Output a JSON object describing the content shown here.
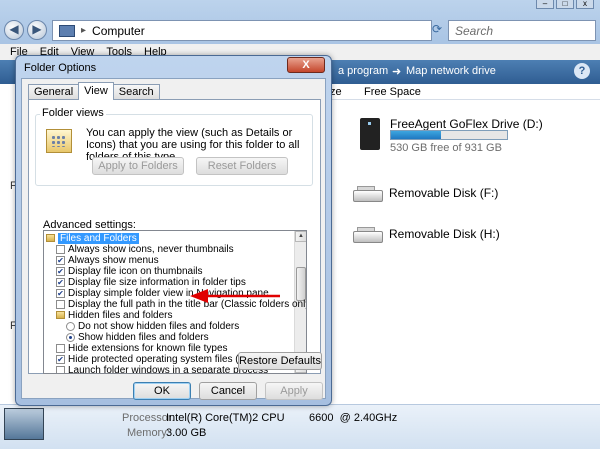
{
  "explorer": {
    "address": "Computer",
    "search_placeholder": "Search",
    "menu": [
      "File",
      "Edit",
      "View",
      "Tools",
      "Help"
    ],
    "toolbar": {
      "item1": "a program",
      "item2": "Map network drive",
      "help_icon": "?"
    },
    "columns": {
      "size": "ze",
      "free_space": "Free Space"
    },
    "drives": [
      {
        "name": "FreeAgent GoFlex Drive (D:)",
        "free_text": "530 GB free of 931 GB",
        "used_fraction": 0.43
      },
      {
        "name": "Removable Disk (F:)"
      },
      {
        "name": "Removable Disk (H:)"
      }
    ],
    "details": {
      "processor_label": "Processor:",
      "processor_value": "Intel(R) Core(TM)2 CPU        6600  @ 2.40GHz",
      "memory_label": "Memory:",
      "memory_value": "3.00 GB"
    },
    "left_stubs": [
      "Fi",
      "Fo"
    ]
  },
  "dialog": {
    "title": "Folder Options",
    "close_glyph": "X",
    "tabs": [
      "General",
      "View",
      "Search"
    ],
    "active_tab": "View",
    "folder_views": {
      "title": "Folder views",
      "text": "You can apply the view (such as Details or Icons) that you are using for this folder to all folders of this type.",
      "apply_button": "Apply to Folders",
      "reset_button": "Reset Folders"
    },
    "advanced_label": "Advanced settings:",
    "tree": [
      {
        "type": "folder",
        "label": "Files and Folders",
        "selected": true,
        "indent": 0
      },
      {
        "type": "check",
        "checked": false,
        "label": "Always show icons, never thumbnails",
        "indent": 1
      },
      {
        "type": "check",
        "checked": true,
        "label": "Always show menus",
        "indent": 1
      },
      {
        "type": "check",
        "checked": true,
        "label": "Display file icon on thumbnails",
        "indent": 1
      },
      {
        "type": "check",
        "checked": true,
        "label": "Display file size information in folder tips",
        "indent": 1
      },
      {
        "type": "check",
        "checked": true,
        "label": "Display simple folder view in Navigation pane",
        "indent": 1
      },
      {
        "type": "check",
        "checked": false,
        "label": "Display the full path in the title bar (Classic folders only)",
        "indent": 1
      },
      {
        "type": "folder",
        "label": "Hidden files and folders",
        "selected": false,
        "indent": 1
      },
      {
        "type": "radio",
        "checked": false,
        "label": "Do not show hidden files and folders",
        "indent": 2
      },
      {
        "type": "radio",
        "checked": true,
        "label": "Show hidden files and folders",
        "indent": 2
      },
      {
        "type": "check",
        "checked": false,
        "label": "Hide extensions for known file types",
        "indent": 1
      },
      {
        "type": "check",
        "checked": true,
        "label": "Hide protected operating system files (Recommended)",
        "indent": 1
      },
      {
        "type": "check",
        "checked": false,
        "label": "Launch folder windows in a separate process",
        "indent": 1
      }
    ],
    "restore_button": "Restore Defaults",
    "ok_button": "OK",
    "cancel_button": "Cancel",
    "apply_button": "Apply"
  }
}
